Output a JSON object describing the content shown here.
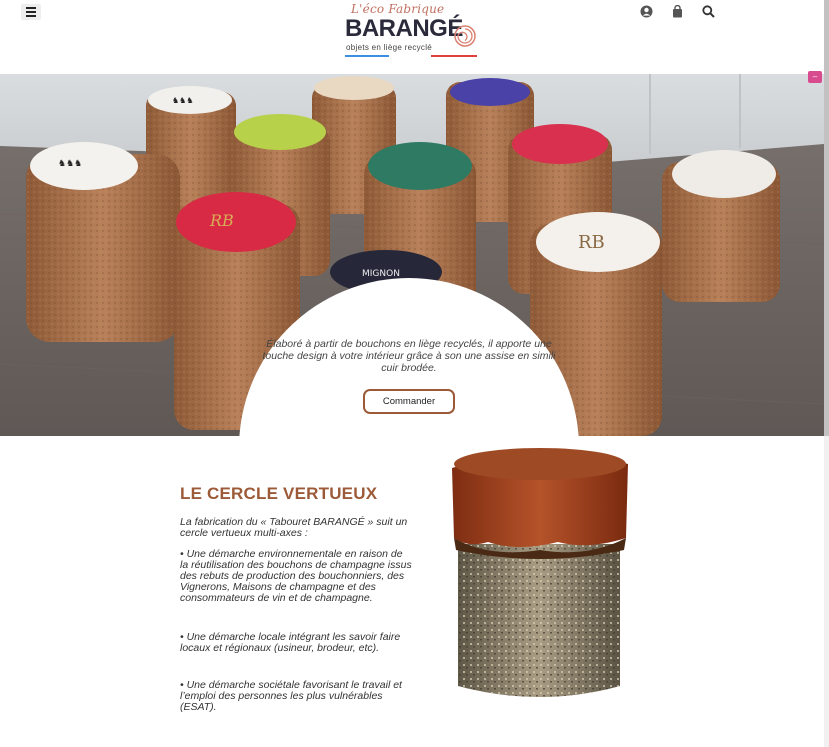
{
  "header": {
    "logo": {
      "script_text": "L'éco Fabrique",
      "brand": "BARANGÉ",
      "tagline": "objets en liège recyclé"
    },
    "icons": [
      "account-icon",
      "shopping-bag-icon",
      "search-icon"
    ]
  },
  "hero": {
    "text": "Élaboré à partir de bouchons en liège recyclés, il apporte une touche design à votre intérieur grâce à son une assise en simili cuir brodée.",
    "cta_label": "Commander",
    "pink_tab_label": "–"
  },
  "section": {
    "title": "LE CERCLE VERTUEUX",
    "paragraphs": [
      "La fabrication du « Tabouret BARANGÉ » suit un cercle vertueux multi-axes :",
      "• Une démarche environnementale en raison de la réutilisation des bouchons de champagne issus des rebuts de production des bouchonniers, des Vignerons, Maisons de champagne et des consommateurs de vin et de champagne.",
      "• Une démarche locale intégrant les savoir faire locaux et régionaux (usineur, brodeur, etc).",
      "• Une démarche sociétale favorisant le travail et l’emploi des personnes les plus vulnérables (ESAT)."
    ]
  },
  "colors": {
    "accent": "#9c5a38",
    "flag_blue": "#3b8ee0",
    "flag_red": "#e0413b",
    "pink_tab": "#d94b8f"
  }
}
